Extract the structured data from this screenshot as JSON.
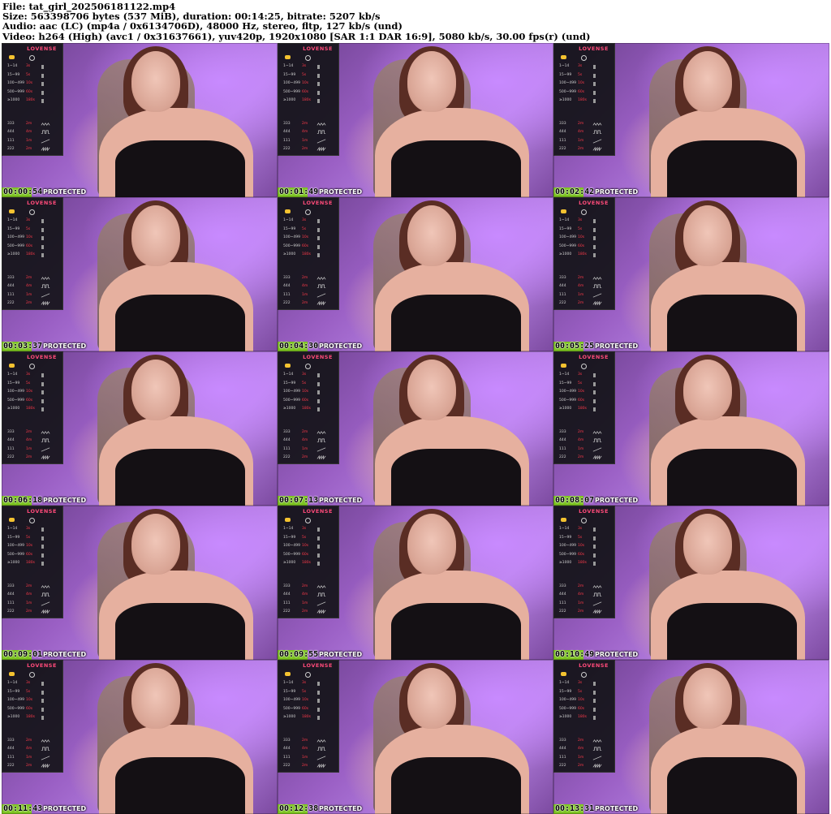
{
  "header": {
    "file": "File: tat_girl_202506181122.mp4",
    "size": "Size: 563398706 bytes (537 MiB), duration: 00:14:25, bitrate: 5207 kb/s",
    "audio": "Audio: aac (LC) (mp4a / 0x6134706D), 48000 Hz, stereo, fltp, 127 kb/s (und)",
    "video": "Video: h264 (High) (avc1 / 0x31637661), yuv420p, 1920x1080 [SAR 1:1 DAR 16:9], 5080 kb/s, 30.00 fps(r) (und)"
  },
  "overlay": {
    "brand": "LOVENSE",
    "tiers": [
      {
        "range": "1~14",
        "duration": "3s"
      },
      {
        "range": "15~99",
        "duration": "5s"
      },
      {
        "range": "100~499",
        "duration": "10s"
      },
      {
        "range": "500~999",
        "duration": "60s"
      },
      {
        "range": "≥1000",
        "duration": "180s"
      }
    ],
    "patterns": [
      {
        "code": "333",
        "duration": "2m"
      },
      {
        "code": "444",
        "duration": "4m"
      },
      {
        "code": "111",
        "duration": "1m"
      },
      {
        "code": "222",
        "duration": "2m"
      }
    ]
  },
  "protected_label": "PROTECTED",
  "thumbnails": [
    {
      "timestamp": "00:00:54"
    },
    {
      "timestamp": "00:01:49"
    },
    {
      "timestamp": "00:02:42"
    },
    {
      "timestamp": "00:03:37"
    },
    {
      "timestamp": "00:04:30"
    },
    {
      "timestamp": "00:05:25"
    },
    {
      "timestamp": "00:06:18"
    },
    {
      "timestamp": "00:07:13"
    },
    {
      "timestamp": "00:08:07"
    },
    {
      "timestamp": "00:09:01"
    },
    {
      "timestamp": "00:09:55"
    },
    {
      "timestamp": "00:10:49"
    },
    {
      "timestamp": "00:11:43"
    },
    {
      "timestamp": "00:12:38"
    },
    {
      "timestamp": "00:13:31"
    }
  ]
}
